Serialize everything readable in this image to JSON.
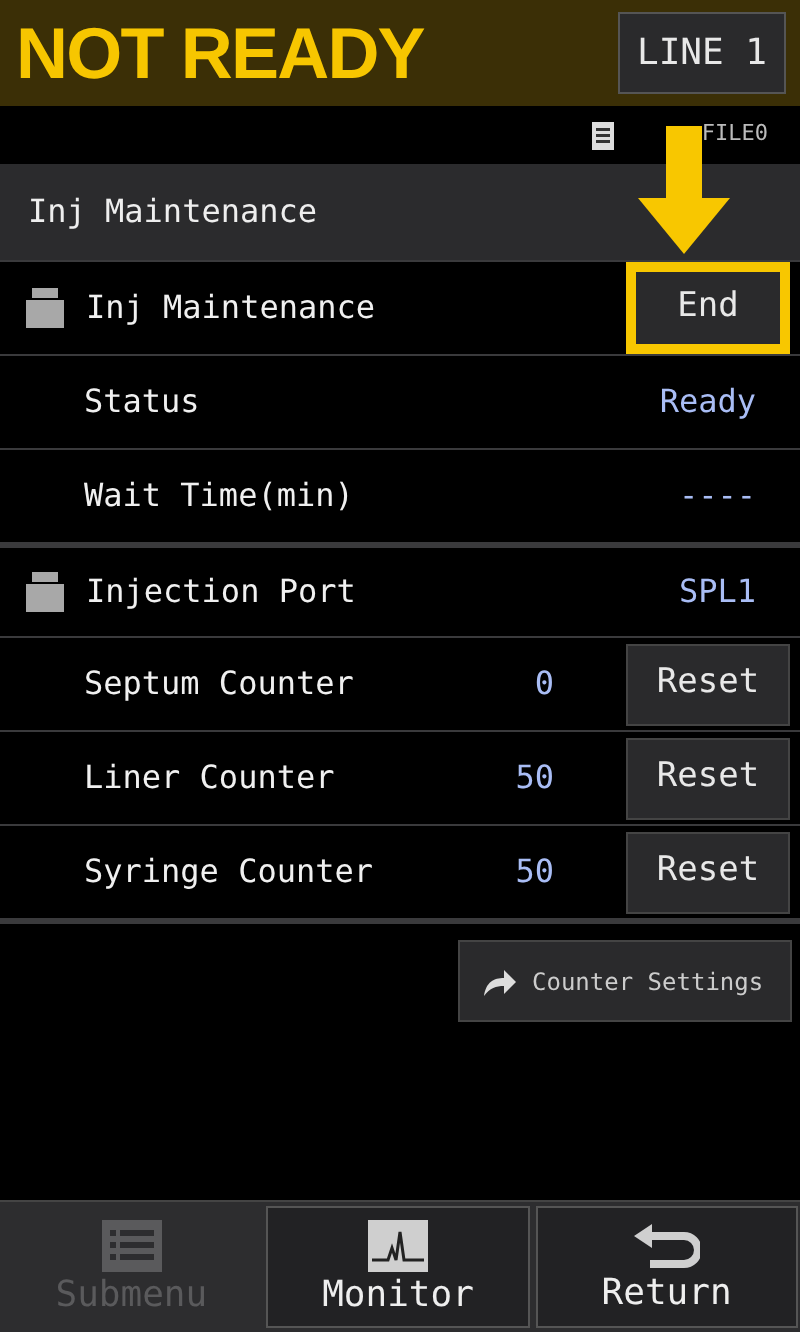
{
  "header": {
    "status": "NOT READY",
    "line_button": "LINE 1"
  },
  "file": {
    "name": "FILE0"
  },
  "section": {
    "title": "Inj Maintenance"
  },
  "rows": [
    {
      "kind": "group",
      "label": "Inj Maintenance",
      "button": {
        "label": "End",
        "highlighted": true
      }
    },
    {
      "kind": "item",
      "label": "Status",
      "value": "Ready"
    },
    {
      "kind": "item",
      "label": "Wait Time(min)",
      "value": "----"
    },
    {
      "kind": "group",
      "label": "Injection Port",
      "value": "SPL1"
    },
    {
      "kind": "item",
      "label": "Septum Counter",
      "value": "0",
      "button": {
        "label": "Reset",
        "highlighted": false
      }
    },
    {
      "kind": "item",
      "label": "Liner Counter",
      "value": "50",
      "button": {
        "label": "Reset",
        "highlighted": false
      }
    },
    {
      "kind": "item",
      "label": "Syringe Counter",
      "value": "50",
      "button": {
        "label": "Reset",
        "highlighted": false
      }
    }
  ],
  "counter_settings": "Counter Settings",
  "footer": [
    {
      "kind": "submenu",
      "label": "Submenu",
      "disabled": true
    },
    {
      "kind": "monitor",
      "label": "Monitor",
      "disabled": false
    },
    {
      "kind": "return",
      "label": "Return",
      "disabled": false
    }
  ]
}
